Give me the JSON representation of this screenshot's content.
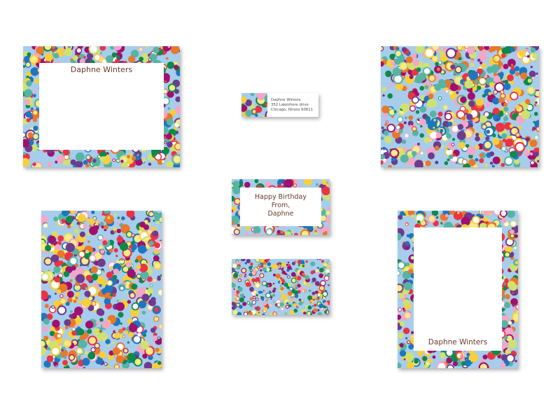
{
  "colors": {
    "background": "#a7cdec",
    "dots": [
      "#e9772c",
      "#1d77c0",
      "#a0106f",
      "#0d8a4b",
      "#56b4a5",
      "#f3a6c6",
      "#cfe270",
      "#f7cf3b",
      "#ea3445",
      "#6e3b8e"
    ],
    "text": "#6b3a2a"
  },
  "stationery": {
    "flat_card_name": "Daphne Winters",
    "address_label": {
      "line1": "Daphne Winters",
      "line2": "352 Lakeshore drive",
      "line3": "Chicago, Illinois 60611"
    },
    "gift_tag": {
      "line1": "Happy Birthday",
      "line2": "From,",
      "line3": "Daphne"
    },
    "notepad_name": "Daphne Winters"
  }
}
